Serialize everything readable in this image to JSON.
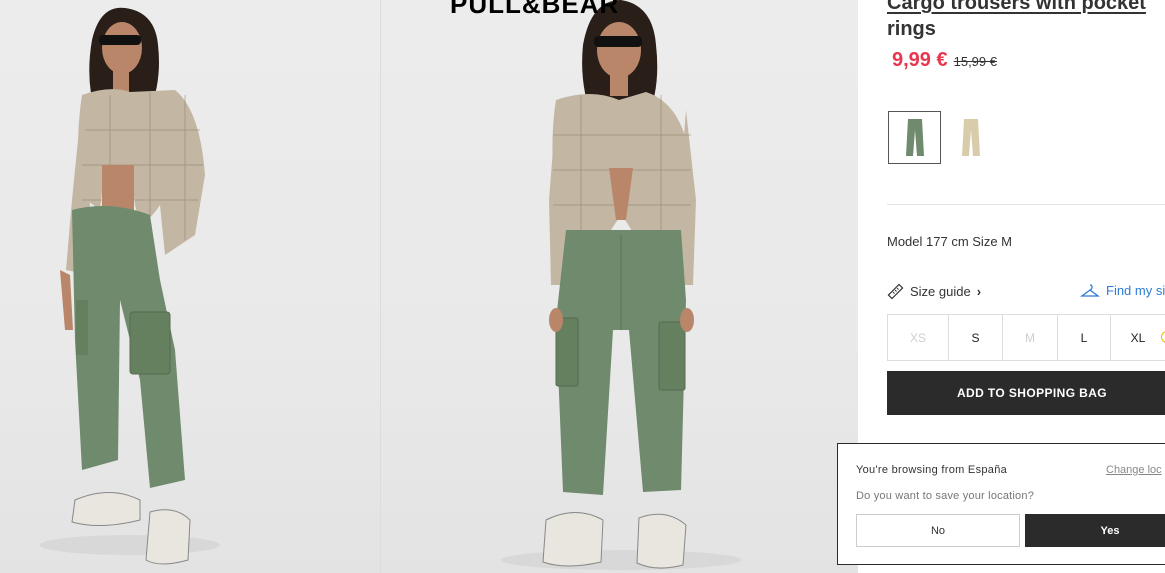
{
  "brand": {
    "logo_text": "PULL&BEAR"
  },
  "gallery": {
    "images": [
      {
        "name": "model-photo-side",
        "alt": "Model wearing cargo trousers, side view"
      },
      {
        "name": "model-photo-front",
        "alt": "Model wearing cargo trousers, front view"
      }
    ]
  },
  "product": {
    "title_line1": "Cargo trousers with pocket",
    "title_line2": "rings",
    "price_current": "9,99 €",
    "price_original": "15,99 €",
    "colors": [
      {
        "name": "khaki green",
        "hex": "#6f8a6c",
        "selected": true
      },
      {
        "name": "beige",
        "hex": "#d9ccab",
        "selected": false
      }
    ],
    "model_info": "Model 177 cm Size M",
    "size_guide_label": "Size guide",
    "find_size_label": "Find my si",
    "sizes": [
      {
        "label": "XS",
        "available": false
      },
      {
        "label": "S",
        "available": true
      },
      {
        "label": "M",
        "available": false
      },
      {
        "label": "L",
        "available": true
      },
      {
        "label": "XL",
        "available": true
      }
    ],
    "add_to_bag_label": "ADD TO SHOPPING BAG"
  },
  "location_popup": {
    "title": "You're browsing from España",
    "change_link": "Change loc",
    "question": "Do you want to save your location?",
    "no_label": "No",
    "yes_label": "Yes"
  },
  "colors": {
    "price_sale": "#e8384f",
    "button_dark": "#2b2b2b",
    "link_blue": "#2e7cd6"
  }
}
